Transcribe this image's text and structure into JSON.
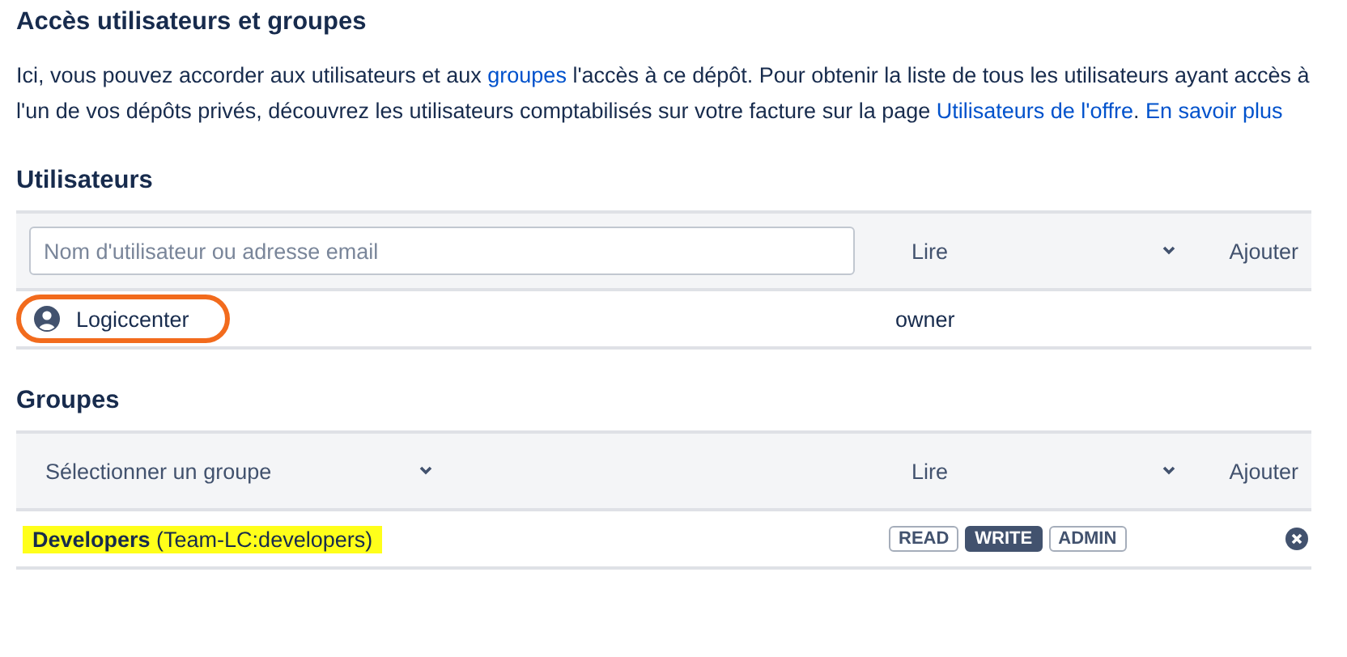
{
  "title": "Accès utilisateurs et groupes",
  "intro": [
    {
      "kind": "text",
      "text": "Ici, vous pouvez accorder aux utilisateurs et aux "
    },
    {
      "kind": "link",
      "text": "groupes"
    },
    {
      "kind": "text",
      "text": " l'accès à ce dépôt. Pour obtenir la liste de tous les utilisateurs ayant accès à l'un de vos dépôts privés, découvrez les utilisateurs comptabilisés sur votre facture sur la page "
    },
    {
      "kind": "link",
      "text": "Utilisateurs de l'offre"
    },
    {
      "kind": "text",
      "text": ". "
    },
    {
      "kind": "link",
      "text": "En savoir plus"
    }
  ],
  "users": {
    "heading": "Utilisateurs",
    "search": {
      "placeholder": "Nom d'utilisateur ou adresse email"
    },
    "permission": "Lire",
    "add": "Ajouter",
    "rows": [
      {
        "name": "Logiccenter",
        "role": "owner",
        "circled": true
      }
    ]
  },
  "groups": {
    "heading": "Groupes",
    "select": {
      "placeholder": "Sélectionner un groupe"
    },
    "permission": "Lire",
    "add": "Ajouter",
    "rows": [
      {
        "name": "Developers",
        "slug": "(Team-LC:developers)",
        "highlighted": true,
        "permissions": [
          {
            "label": "READ",
            "selected": false
          },
          {
            "label": "WRITE",
            "selected": true
          },
          {
            "label": "ADMIN",
            "selected": false
          }
        ]
      }
    ]
  }
}
